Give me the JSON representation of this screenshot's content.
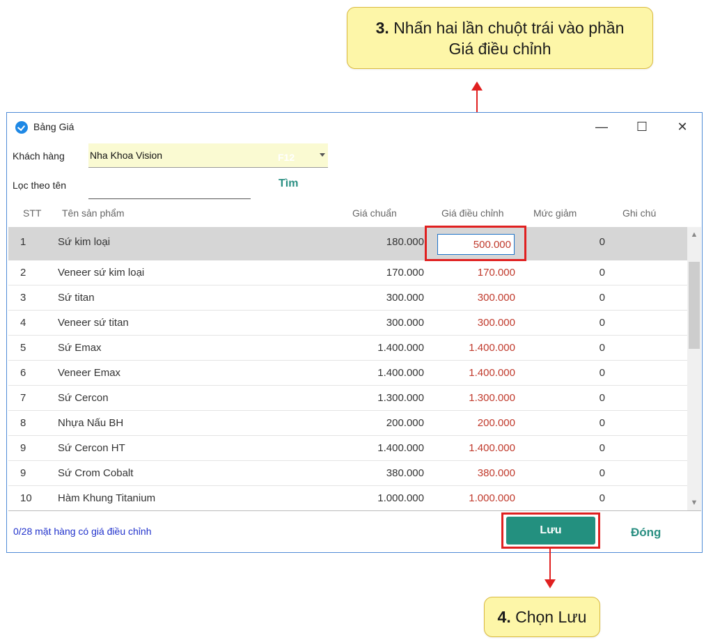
{
  "annotations": {
    "step3_number": "3.",
    "step3_line1": "Nhấn hai lần chuột trái vào phần",
    "step3_line2": "Giá điều chỉnh",
    "step4_number": "4.",
    "step4_text": "Chọn Lưu",
    "callout_bg": "#fdf6a8",
    "highlight_color": "#e02020"
  },
  "window": {
    "title": "Bảng Giá",
    "minimize_glyph": "—",
    "maximize_glyph": "☐",
    "close_glyph": "✕",
    "border_color": "#4f8bd6"
  },
  "form": {
    "customer_label": "Khách hàng",
    "customer_value": "Nha Khoa Vision",
    "customer_shortcut": "F12",
    "filter_label": "Lọc theo tên",
    "filter_value": "",
    "search_label": "Tìm"
  },
  "table": {
    "columns": [
      "STT",
      "Tên sản phẩm",
      "Giá chuẩn",
      "Giá điều chỉnh",
      "Mức giảm",
      "Ghi chú"
    ],
    "rows": [
      {
        "stt": "1",
        "name": "Sứ kim loại",
        "std": "180.000",
        "adj": "500.000",
        "disc": "0",
        "note": ""
      },
      {
        "stt": "2",
        "name": "Veneer sứ kim loại",
        "std": "170.000",
        "adj": "170.000",
        "disc": "0",
        "note": ""
      },
      {
        "stt": "3",
        "name": "Sứ titan",
        "std": "300.000",
        "adj": "300.000",
        "disc": "0",
        "note": ""
      },
      {
        "stt": "4",
        "name": "Veneer sứ titan",
        "std": "300.000",
        "adj": "300.000",
        "disc": "0",
        "note": ""
      },
      {
        "stt": "5",
        "name": "Sứ Emax",
        "std": "1.400.000",
        "adj": "1.400.000",
        "disc": "0",
        "note": ""
      },
      {
        "stt": "6",
        "name": "Veneer Emax",
        "std": "1.400.000",
        "adj": "1.400.000",
        "disc": "0",
        "note": ""
      },
      {
        "stt": "7",
        "name": "Sứ Cercon",
        "std": "1.300.000",
        "adj": "1.300.000",
        "disc": "0",
        "note": ""
      },
      {
        "stt": "8",
        "name": "Nhựa Nấu BH",
        "std": "200.000",
        "adj": "200.000",
        "disc": "0",
        "note": ""
      },
      {
        "stt": "9",
        "name": "Sứ Cercon HT",
        "std": "1.400.000",
        "adj": "1.400.000",
        "disc": "0",
        "note": ""
      },
      {
        "stt": "9",
        "name": "Sứ Crom Cobalt",
        "std": "380.000",
        "adj": "380.000",
        "disc": "0",
        "note": ""
      },
      {
        "stt": "10",
        "name": "Hàm Khung Titanium",
        "std": "1.000.000",
        "adj": "1.000.000",
        "disc": "0",
        "note": ""
      }
    ],
    "selected_row_index": 0,
    "adjusted_price_color": "#c0392b"
  },
  "footer": {
    "status": "0/28 mặt hàng có giá điều chỉnh",
    "save_label": "Lưu",
    "close_label": "Đóng",
    "accent": "#23907f"
  }
}
